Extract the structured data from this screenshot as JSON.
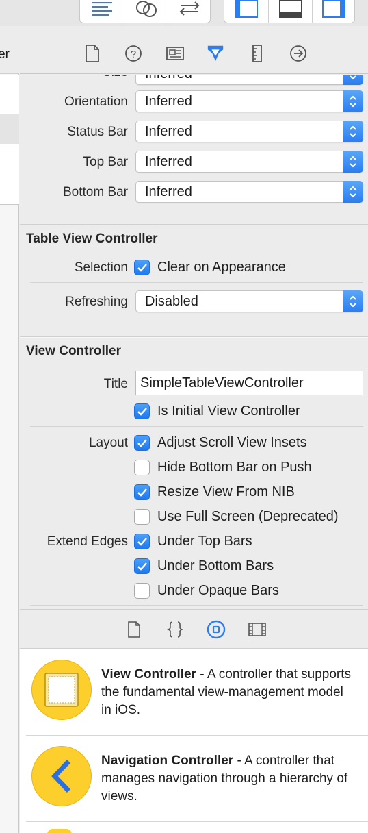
{
  "left_panel": {
    "header_fragment": "er"
  },
  "simulated_metrics": {
    "rows": [
      {
        "label": "Size",
        "value": "Inferred"
      },
      {
        "label": "Orientation",
        "value": "Inferred"
      },
      {
        "label": "Status Bar",
        "value": "Inferred"
      },
      {
        "label": "Top Bar",
        "value": "Inferred"
      },
      {
        "label": "Bottom Bar",
        "value": "Inferred"
      }
    ]
  },
  "table_view_controller": {
    "title": "Table View Controller",
    "selection_label": "Selection",
    "selection_option": "Clear on Appearance",
    "refreshing_label": "Refreshing",
    "refreshing_value": "Disabled"
  },
  "view_controller": {
    "title": "View Controller",
    "title_label": "Title",
    "title_value": "SimpleTableViewController",
    "initial_vc": "Is Initial View Controller",
    "layout_label": "Layout",
    "layout_options": [
      {
        "label": "Adjust Scroll View Insets",
        "checked": true
      },
      {
        "label": "Hide Bottom Bar on Push",
        "checked": false
      },
      {
        "label": "Resize View From NIB",
        "checked": true
      },
      {
        "label": "Use Full Screen (Deprecated)",
        "checked": false
      }
    ],
    "extend_edges_label": "Extend Edges",
    "extend_edges_options": [
      {
        "label": "Under Top Bars",
        "checked": true
      },
      {
        "label": "Under Bottom Bars",
        "checked": true
      },
      {
        "label": "Under Opaque Bars",
        "checked": false
      }
    ]
  },
  "library": {
    "items": [
      {
        "name": "View Controller",
        "description": " - A controller that supports the fundamental view-management model in iOS."
      },
      {
        "name": "Navigation Controller",
        "description": " - A controller that manages navigation through a hierarchy of views."
      }
    ]
  },
  "colors": {
    "accent": "#2b7df0",
    "library_icon": "#fccf2c"
  }
}
